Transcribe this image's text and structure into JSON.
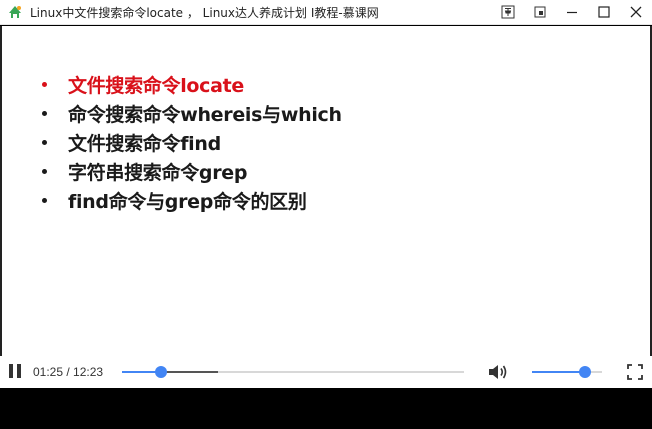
{
  "window": {
    "title": "Linux中文件搜索命令locate ， Linux达人养成计划 I教程-慕课网",
    "icons": {
      "app": "app-icon",
      "pin": "pin-icon",
      "restore": "restore-icon",
      "minimize": "minimize-icon",
      "maximize": "maximize-icon",
      "close": "close-icon"
    }
  },
  "slide": {
    "items": [
      {
        "label": "文件搜索命令locate",
        "active": true
      },
      {
        "label": "命令搜索命令whereis与which",
        "active": false
      },
      {
        "label": "文件搜索命令find",
        "active": false
      },
      {
        "label": "字符串搜索命令grep",
        "active": false
      },
      {
        "label": "find命令与grep命令的区别",
        "active": false
      }
    ],
    "active_color": "#d9111a",
    "text_color": "#1a1a1a"
  },
  "player": {
    "current_time": "01:25",
    "separator": " / ",
    "duration": "12:23",
    "time_display": "01:25 / 12:23",
    "progress_fraction": 0.114,
    "buffer_fraction": 0.28,
    "volume_fraction": 0.75,
    "accent_color": "#4285f4",
    "icons": {
      "play_pause": "pause-icon",
      "volume": "volume-icon",
      "fullscreen": "fullscreen-icon"
    }
  }
}
